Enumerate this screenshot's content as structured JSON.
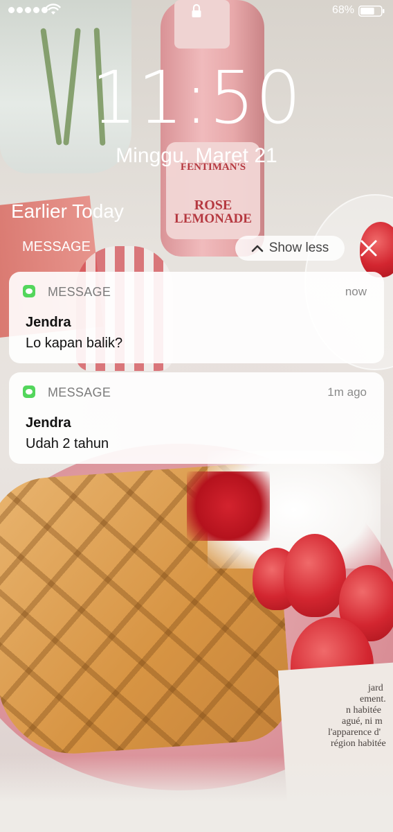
{
  "status_bar": {
    "battery_percent": "68%",
    "battery_level": 0.68,
    "signal_bars": 5,
    "icons": [
      "signal-dots-icon",
      "wifi-icon",
      "lock-icon",
      "battery-icon"
    ]
  },
  "clock": {
    "time": "11:50",
    "date": "Minggu, Maret 21"
  },
  "notifications_section": {
    "title": "Earlier Today",
    "group_label": "MESSAGE",
    "show_less_label": "Show less",
    "close_icon": "close-icon"
  },
  "notifications": [
    {
      "app": "MESSAGE",
      "time": "now",
      "sender": "Jendra",
      "body": "Lo kapan balik?"
    },
    {
      "app": "MESSAGE",
      "time": "1m ago",
      "sender": "Jendra",
      "body": "Udah 2 tahun"
    }
  ],
  "wallpaper": {
    "bottle_label_lines": [
      "FENTIMAN'S",
      "ROSE",
      "LEMONADE"
    ],
    "paper_lines": [
      "jard",
      "ement.",
      "n habitée",
      "agué, ni m",
      "l'apparence d'",
      "région habitée"
    ]
  },
  "colors": {
    "app_icon": "#53d65c",
    "card": "#ffffff",
    "text_on_wallpaper": "#ffffff"
  }
}
